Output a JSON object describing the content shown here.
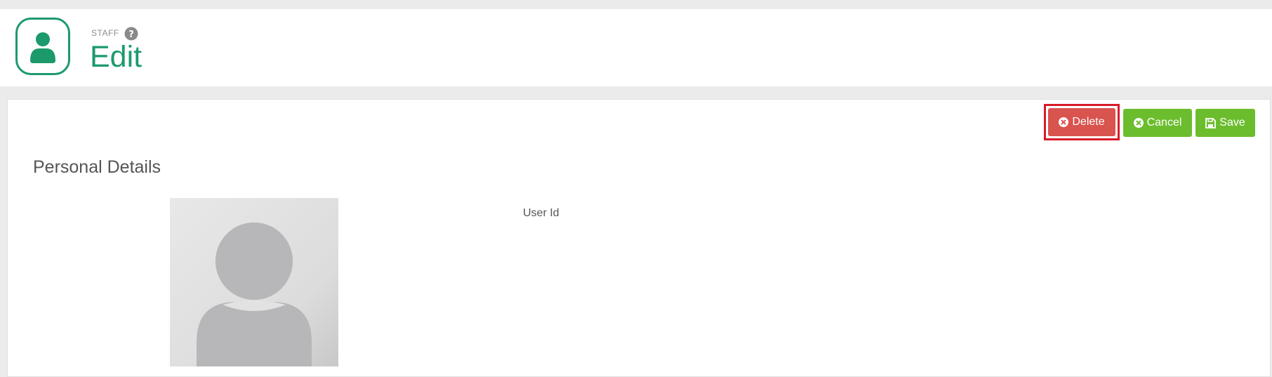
{
  "header": {
    "module_label": "STAFF",
    "title": "Edit",
    "logo_icon": "user-icon",
    "help_icon": "question-circle-icon",
    "accent_color": "#1c9a6c"
  },
  "toolbar": {
    "delete_label": "Delete",
    "cancel_label": "Cancel",
    "save_label": "Save",
    "delete_color": "#d9534f",
    "action_color": "#6cbd2e"
  },
  "form": {
    "section_title": "Personal Details",
    "fields": [
      {
        "label": "User Id",
        "value": ""
      }
    ]
  }
}
